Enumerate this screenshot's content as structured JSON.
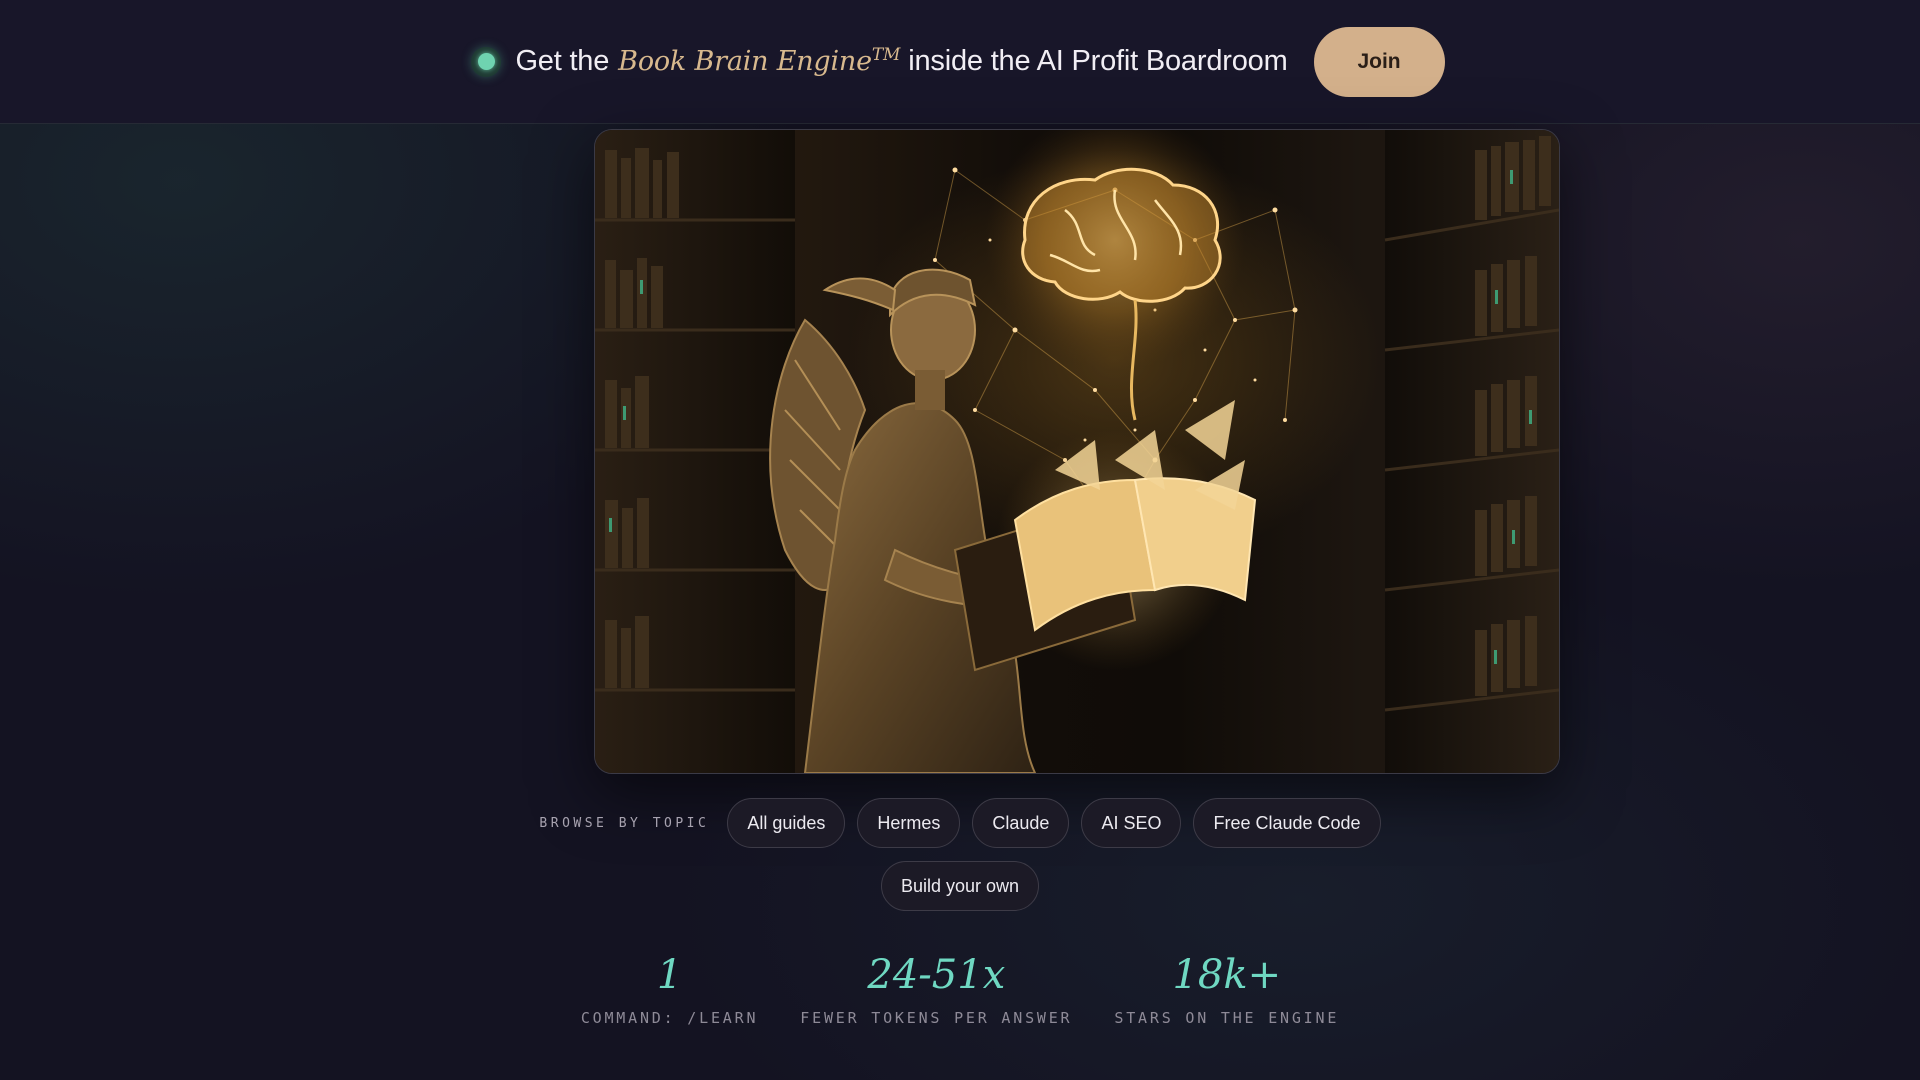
{
  "banner": {
    "prefix": "Get the",
    "brand": "Book Brain Engine",
    "trademark": "TM",
    "suffix": "inside the AI Profit Boardroom",
    "join_label": "Join"
  },
  "hero": {
    "icons": [
      "hermes-statue",
      "glowing-brain",
      "open-book",
      "library-shelves"
    ]
  },
  "topics": {
    "label": "BROWSE BY TOPIC",
    "items": [
      {
        "label": "All guides"
      },
      {
        "label": "Hermes"
      },
      {
        "label": "Claude"
      },
      {
        "label": "AI SEO"
      },
      {
        "label": "Free Claude Code"
      },
      {
        "label": "Build your own"
      }
    ]
  },
  "stats": [
    {
      "value": "1",
      "label": "COMMAND: /LEARN"
    },
    {
      "value": "24-51x",
      "label": "FEWER TOKENS PER ANSWER"
    },
    {
      "value": "18k+",
      "label": "STARS ON THE ENGINE"
    }
  ],
  "colors": {
    "background": "#141322",
    "accent_gold": "#d3b08b",
    "accent_teal": "#6fd8c2",
    "status_dot": "#6fd3b0"
  }
}
